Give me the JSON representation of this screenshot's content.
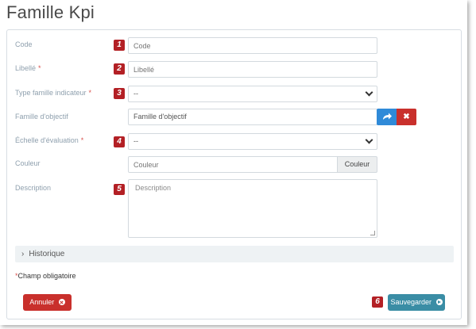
{
  "page": {
    "title": "Famille Kpi"
  },
  "form": {
    "code": {
      "label": "Code",
      "placeholder": "Code",
      "badge": "1"
    },
    "libelle": {
      "label": "Libellé",
      "required_mark": "*",
      "placeholder": "Libellé",
      "badge": "2"
    },
    "type_famille": {
      "label": "Type famille indicateur",
      "required_mark": "*",
      "value": "--",
      "badge": "3"
    },
    "famille_objectif": {
      "label": "Famille d'objectif",
      "value": "Famille d'objectif",
      "clear_symbol": "✖"
    },
    "echelle": {
      "label": "Échelle d'évaluation",
      "required_mark": "*",
      "value": "--",
      "badge": "4"
    },
    "couleur": {
      "label": "Couleur",
      "placeholder": "Couleur",
      "addon": "Couleur"
    },
    "description": {
      "label": "Description",
      "placeholder": "Description",
      "badge": "5"
    }
  },
  "historique": {
    "label": "Historique"
  },
  "mandatory_note": {
    "star": "*",
    "text": "Champ obligatoire"
  },
  "actions": {
    "cancel_label": "Annuler",
    "save_label": "Sauvegarder",
    "save_badge": "6"
  },
  "colors": {
    "badge": "#b32025",
    "primary": "#2f8ad8",
    "danger": "#c9302c",
    "save": "#3a8da5"
  },
  "icons": {
    "share": "share-icon",
    "clear": "times-icon",
    "cancel": "times-circle-icon",
    "save": "arrow-circle-right-icon",
    "chevron": "chevron-down-icon",
    "expand": "chevron-right-icon"
  }
}
